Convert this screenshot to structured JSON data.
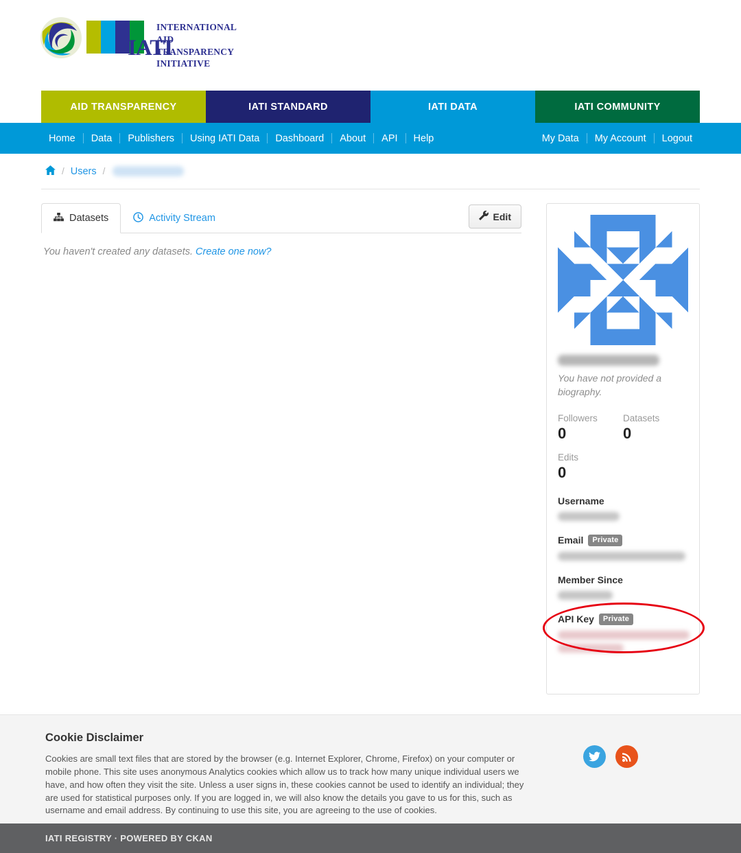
{
  "brand": {
    "acronym": "IATI",
    "org_name_lines": [
      "INTERNATIONAL",
      "AID",
      "TRANSPARENCY",
      "INITIATIVE"
    ],
    "logo_icon": "iati-globe-logo"
  },
  "primary_nav": {
    "items": [
      {
        "label": "AID TRANSPARENCY",
        "color": "#b0bc00"
      },
      {
        "label": "IATI STANDARD",
        "color": "#1f2370"
      },
      {
        "label": "IATI DATA",
        "color": "#0099d8"
      },
      {
        "label": "IATI COMMUNITY",
        "color": "#006b3f"
      }
    ]
  },
  "secondary_nav": {
    "background": "#0099d8",
    "left_items": [
      "Home",
      "Data",
      "Publishers",
      "Using IATI Data",
      "Dashboard",
      "About",
      "API",
      "Help"
    ],
    "right_items": [
      "My Data",
      "My Account",
      "Logout"
    ]
  },
  "breadcrumb": {
    "home_icon": "home-icon",
    "separator": "/",
    "users_label": "Users",
    "current_label": ""
  },
  "tabs": [
    {
      "label": "Datasets",
      "icon": "sitemap-icon",
      "active": true
    },
    {
      "label": "Activity Stream",
      "icon": "clock-icon",
      "active": false
    }
  ],
  "edit_button": {
    "label": "Edit",
    "icon": "wrench-icon"
  },
  "datasets_panel": {
    "empty_text": "You haven't created any datasets.",
    "empty_link": "Create one now?"
  },
  "profile_card": {
    "avatar_icon": "identicon-avatar",
    "avatar_color": "#4a90e2",
    "display_name": "",
    "biography": "You have not provided a biography.",
    "stats": [
      {
        "label": "Followers",
        "value": "0"
      },
      {
        "label": "Datasets",
        "value": "0"
      },
      {
        "label": "Edits",
        "value": "0"
      }
    ],
    "fields": [
      {
        "label": "Username",
        "badge": "",
        "value": ""
      },
      {
        "label": "Email",
        "badge": "Private",
        "value": ""
      },
      {
        "label": "Member Since",
        "badge": "",
        "value": ""
      },
      {
        "label": "API Key",
        "badge": "Private",
        "value": ""
      }
    ],
    "annotation": {
      "shape": "ellipse",
      "color": "#e60012",
      "target": "API Key"
    }
  },
  "footer": {
    "cookie_title": "Cookie Disclaimer",
    "cookie_body": "Cookies are small text files that are stored by the browser (e.g. Internet Explorer, Chrome, Firefox) on your computer or mobile phone. This site uses anonymous Analytics cookies which allow us to track how many unique individual users we have, and how often they visit the site. Unless a user signs in, these cookies cannot be used to identify an individual; they are used for statistical purposes only. If you are logged in, we will also know the details you gave to us for this, such as username and email address. By continuing to use this site, you are agreeing to the use of cookies.",
    "social": [
      {
        "name": "twitter-icon",
        "color": "#3aa4e0"
      },
      {
        "name": "rss-icon",
        "color": "#e8531b"
      }
    ]
  },
  "bottom_bar": {
    "text": "IATI REGISTRY · POWERED BY CKAN",
    "background": "#5f6062"
  }
}
